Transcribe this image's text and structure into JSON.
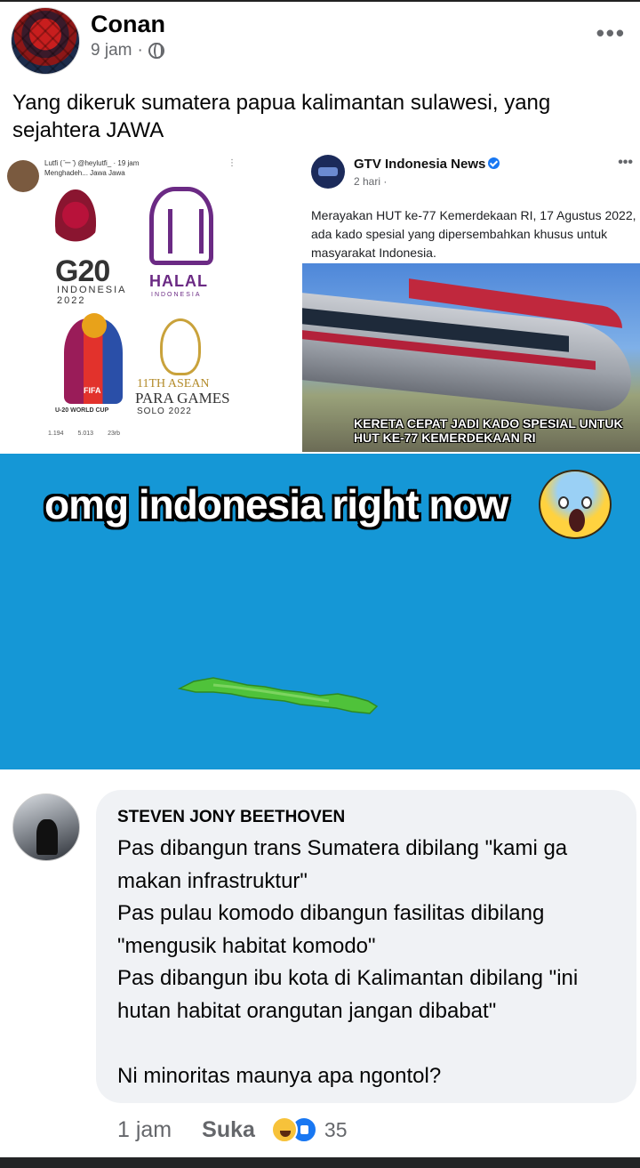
{
  "post": {
    "author": "Conan",
    "time": "9 jam",
    "separator": "·",
    "more": "•••",
    "text": "Yang dikeruk sumatera papua kalimantan sulawesi, yang sejahtera JAWA"
  },
  "meme": {
    "tweet": {
      "name": "Lutfi ( ̄ー ̄) @heylutfi_ · 19 jam",
      "text": "Menghadeh... Jawa Jawa",
      "dots": "⋮",
      "logos": {
        "g20": "G20",
        "g20_sub": "INDONESIA 2022",
        "halal": "HALAL",
        "halal_sub": "INDONESIA",
        "fifa": "FIFA",
        "fifa_sub": "U-20 WORLD CUP",
        "asean1": "11TH ASEAN",
        "asean2": "PARA GAMES",
        "asean3": "SOLO 2022"
      },
      "actions": {
        "replies": "1.194",
        "retweets": "5.013",
        "likes": "23rb"
      }
    },
    "gtv": {
      "name": "GTV Indonesia News",
      "meta": "2 hari ·",
      "dots": "•••",
      "caption": "Merayakan HUT ke-77 Kemerdekaan RI, 17 Agustus 2022, ada kado spesial yang dipersembahkan khusus untuk masyarakat Indonesia.",
      "photo_caption": "KERETA CEPAT JADI KADO SPESIAL UNTUK HUT KE-77 KEMERDEKAAN RI"
    },
    "title": "omg indonesia right now",
    "colors": {
      "background": "#1597d6",
      "island": "#4fc23a"
    }
  },
  "comment": {
    "author": "STEVEN JONY BEETHOVEN",
    "text": "Pas dibangun trans Sumatera dibilang \"kami ga makan infrastruktur\"\nPas pulau komodo dibangun fasilitas dibilang \"mengusik habitat komodo\"\nPas dibangun ibu kota di Kalimantan dibilang \"ini hutan habitat orangutan jangan dibabat\"\n\nNi minoritas maunya apa ngontol?",
    "time": "1 jam",
    "like_label": "Suka",
    "reaction_count": "35",
    "reactions": [
      "haha-icon",
      "like-icon"
    ]
  }
}
